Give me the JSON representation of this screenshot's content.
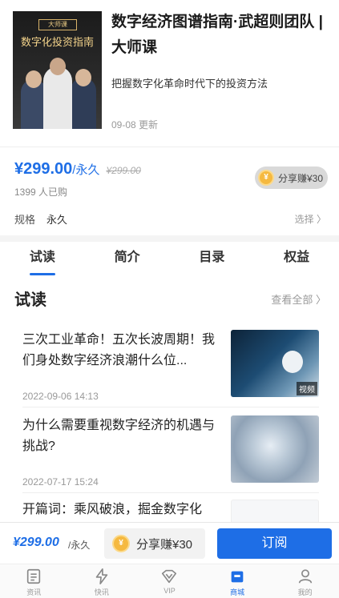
{
  "product": {
    "cover_badge": "大师课",
    "cover_title": "数字化投资指南",
    "title": "数字经济图谱指南·武超则团队 | 大师课",
    "subtitle": "把握数字化革命时代下的投资方法",
    "updated": "09-08 更新"
  },
  "pricing": {
    "price": "¥299.00",
    "unit": "/永久",
    "original_price": "¥299.00",
    "sold": "1399 人已购",
    "share_label": "分享赚¥30",
    "spec_label": "规格",
    "spec_value": "永久",
    "choose": "选择 〉"
  },
  "tabs": [
    "试读",
    "简介",
    "目录",
    "权益"
  ],
  "section": {
    "title": "试读",
    "more": "查看全部 〉"
  },
  "items": [
    {
      "title": "三次工业革命！五次长波周期！我们身处数字经济浪潮什么位...",
      "date": "2022-09-06 14:13",
      "badge": "视频"
    },
    {
      "title": "为什么需要重视数字经济的机遇与挑战?",
      "date": "2022-07-17 15:24"
    },
    {
      "title": "开篇词：乘风破浪，掘金数字化"
    }
  ],
  "buybar": {
    "price": "¥299.00",
    "unit": "/永久",
    "share": "分享赚¥30",
    "subscribe": "订阅"
  },
  "tabbar": [
    {
      "label": "资讯",
      "icon": "news-icon"
    },
    {
      "label": "快讯",
      "icon": "lightning-icon"
    },
    {
      "label": "VIP",
      "icon": "vip-icon"
    },
    {
      "label": "商城",
      "icon": "shop-icon"
    },
    {
      "label": "我的",
      "icon": "user-icon"
    }
  ],
  "colors": {
    "accent": "#1e6ee6",
    "coin": "#f5b940"
  }
}
